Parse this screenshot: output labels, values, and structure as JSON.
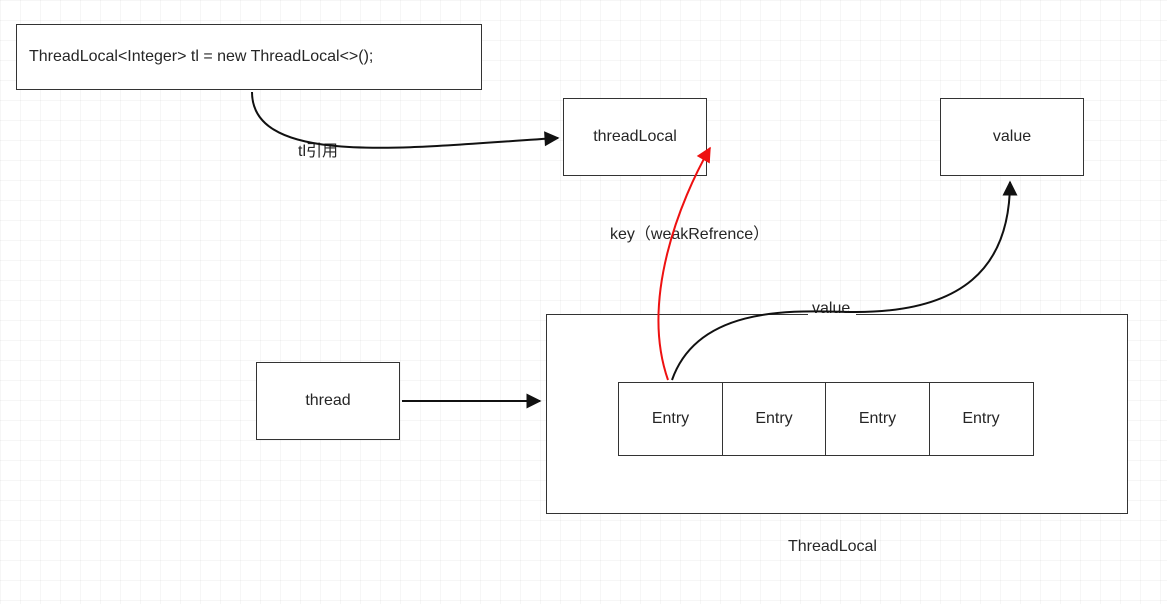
{
  "codeBox": "ThreadLocal<Integer> tl = new ThreadLocal<>();",
  "threadLocalObj": "threadLocal",
  "valueObj": "value",
  "threadBox": "thread",
  "entries": [
    "Entry",
    "Entry",
    "Entry",
    "Entry"
  ],
  "threadLocalMapLabel": "ThreadLocal",
  "edges": {
    "tlRef": "tl引用",
    "key": "key（weakRefrence）",
    "value": "value"
  }
}
